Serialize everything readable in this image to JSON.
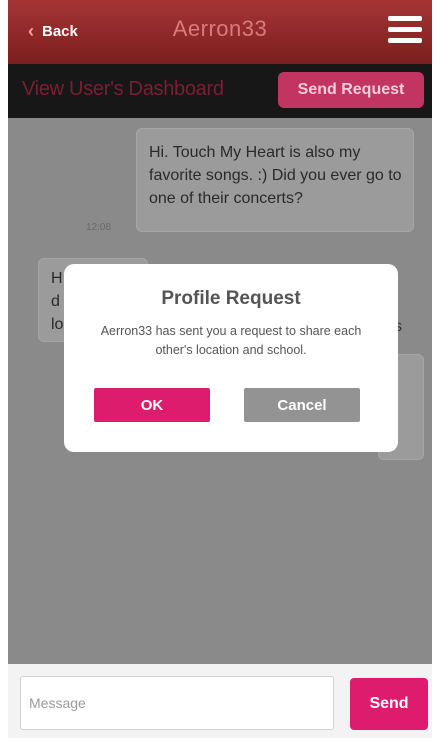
{
  "header": {
    "back_label": "Back",
    "title": "Aerron33",
    "menu_icon": "hamburger-menu-icon"
  },
  "subbar": {
    "dashboard_link": "View User's Dashboard",
    "send_request_label": "Send Request"
  },
  "chat": {
    "messages": [
      {
        "text": "Hi. Touch My Heart is also my favorite songs. :) Did you ever go to one of their concerts?",
        "time": "12:08"
      },
      {
        "text": "H\nd\nlo",
        "trail": "s"
      }
    ]
  },
  "modal": {
    "title": "Profile Request",
    "message": "Aerron33 has sent you a request to share each other's location and school.",
    "ok_label": "OK",
    "cancel_label": "Cancel"
  },
  "footer": {
    "message_placeholder": "Message",
    "send_label": "Send"
  },
  "colors": {
    "header_red": "#8e2828",
    "accent_pink": "#de1c6d",
    "overlay_gray": "#888888",
    "cancel_gray": "#939393"
  }
}
